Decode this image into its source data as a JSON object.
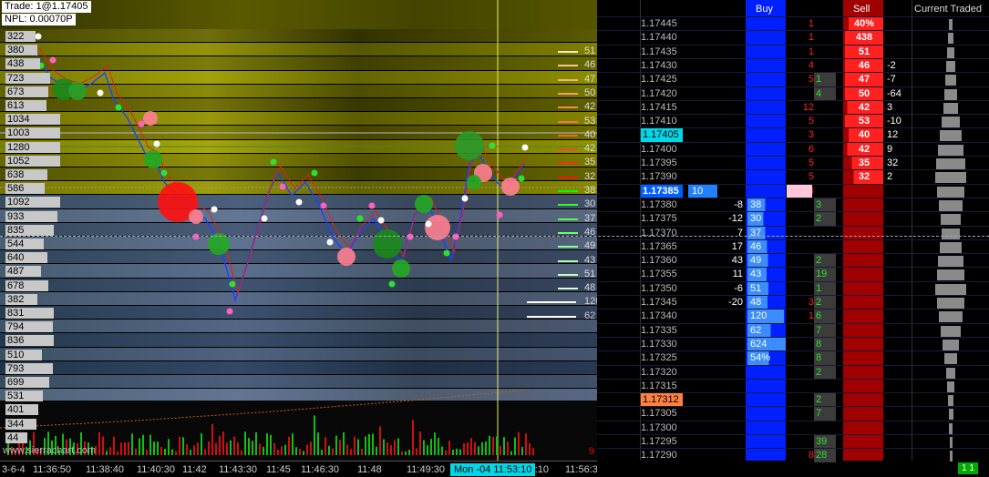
{
  "chart": {
    "trade_label": "Trade: 1@1.17405",
    "npl_label": "NPL: 0.00070P",
    "watermark": "www.sierrachart.com",
    "corner_value": "9",
    "volume_profile": [
      "322",
      "380",
      "438",
      "723",
      "673",
      "613",
      "1034",
      "1003",
      "1280",
      "1052",
      "638",
      "586",
      "1092",
      "933",
      "835",
      "544",
      "640",
      "487",
      "678",
      "382",
      "831",
      "794",
      "836",
      "510",
      "793",
      "699",
      "531",
      "401",
      "344",
      "44"
    ],
    "trades_right": [
      {
        "value": "51",
        "color": "#f4e6c8"
      },
      {
        "value": "46",
        "color": "#f0c88c"
      },
      {
        "value": "47",
        "color": "#f0b478"
      },
      {
        "value": "50",
        "color": "#f0a064"
      },
      {
        "value": "42",
        "color": "#f08c50"
      },
      {
        "value": "53",
        "color": "#f0783c"
      },
      {
        "value": "40",
        "color": "#f06428"
      },
      {
        "value": "42",
        "color": "#f04a1e"
      },
      {
        "value": "35",
        "color": "#f03014"
      },
      {
        "value": "32",
        "color": "#ff1010"
      },
      {
        "value": "38",
        "color": "#00ff00"
      },
      {
        "value": "30",
        "color": "#2cff2c"
      },
      {
        "value": "37",
        "color": "#4cff4c"
      },
      {
        "value": "46",
        "color": "#6cff6c"
      },
      {
        "value": "49",
        "color": "#8cff8c"
      },
      {
        "value": "43",
        "color": "#a8ffa8"
      },
      {
        "value": "51",
        "color": "#c0ffc0"
      },
      {
        "value": "48",
        "color": "#d8ffd8"
      },
      {
        "value": "120",
        "color": "#ffffff"
      },
      {
        "value": "62",
        "color": "#ffffff"
      }
    ],
    "x_ticks": [
      "3-6-4",
      "11:36:50",
      "11:38:40",
      "11:40:30",
      "11:42",
      "11:43:30",
      "11:45",
      "11:46:30",
      "11:48",
      "11:49:30",
      "11:51",
      "11:53:10",
      "11:56:30"
    ],
    "cursor_time": "Mon -04  11:53:10"
  },
  "dom": {
    "header_buy": "Buy",
    "header_sell": "Sell",
    "header_current_traded": "Current Traded",
    "bottom_badge": "1 1",
    "rows": [
      {
        "price": "1.17445",
        "bid": "",
        "ask": "40%",
        "last_buy": "",
        "last_sell": "1",
        "cur": ""
      },
      {
        "price": "1.17440",
        "bid": "",
        "ask": "438",
        "last_buy": "",
        "last_sell": "1",
        "cur": ""
      },
      {
        "price": "1.17435",
        "bid": "",
        "ask": "51",
        "last_buy": "",
        "last_sell": "1",
        "cur": ""
      },
      {
        "price": "1.17430",
        "bid": "",
        "ask": "46",
        "last_buy": "",
        "last_sell": "4",
        "cur": "-2"
      },
      {
        "price": "1.17425",
        "bid": "",
        "ask": "47",
        "last_buy": "1",
        "last_sell": "5",
        "cur": "-7"
      },
      {
        "price": "1.17420",
        "bid": "",
        "ask": "50",
        "last_buy": "4",
        "last_sell": "",
        "cur": "-64"
      },
      {
        "price": "1.17415",
        "bid": "",
        "ask": "42",
        "last_buy": "",
        "last_sell": "12",
        "cur": "3"
      },
      {
        "price": "1.17410",
        "bid": "",
        "ask": "53",
        "last_buy": "",
        "last_sell": "5",
        "cur": "-10"
      },
      {
        "price": "1.17405",
        "bid": "",
        "ask": "40",
        "last_buy": "",
        "last_sell": "3",
        "cur": "12"
      },
      {
        "price": "1.17400",
        "bid": "",
        "ask": "42",
        "last_buy": "",
        "last_sell": "6",
        "cur": "9"
      },
      {
        "price": "1.17395",
        "bid": "",
        "ask": "35",
        "last_buy": "",
        "last_sell": "5",
        "cur": "32"
      },
      {
        "price": "1.17390",
        "bid": "",
        "ask": "32",
        "last_buy": "",
        "last_sell": "5",
        "cur": "2"
      },
      {
        "price": "1.17385",
        "bid": "10",
        "ask": "",
        "last_buy": "",
        "last_sell": "4",
        "cur": ""
      },
      {
        "price": "1.17380",
        "bid": "38",
        "ask": "",
        "last_buy": "3",
        "last_sell": "",
        "cur": "-8"
      },
      {
        "price": "1.17375",
        "bid": "30",
        "ask": "",
        "last_buy": "2",
        "last_sell": "",
        "cur": "-12"
      },
      {
        "price": "1.17370",
        "bid": "37",
        "ask": "",
        "last_buy": "",
        "last_sell": "",
        "cur": "7"
      },
      {
        "price": "1.17365",
        "bid": "46",
        "ask": "",
        "last_buy": "",
        "last_sell": "",
        "cur": "17"
      },
      {
        "price": "1.17360",
        "bid": "49",
        "ask": "",
        "last_buy": "2",
        "last_sell": "",
        "cur": "43"
      },
      {
        "price": "1.17355",
        "bid": "43",
        "ask": "",
        "last_buy": "19",
        "last_sell": "",
        "cur": "11"
      },
      {
        "price": "1.17350",
        "bid": "51",
        "ask": "",
        "last_buy": "1",
        "last_sell": "",
        "cur": "-6"
      },
      {
        "price": "1.17345",
        "bid": "48",
        "ask": "",
        "last_buy": "2",
        "last_sell": "3",
        "cur": "-20"
      },
      {
        "price": "1.17340",
        "bid": "120",
        "ask": "",
        "last_buy": "6",
        "last_sell": "1",
        "cur": ""
      },
      {
        "price": "1.17335",
        "bid": "62",
        "ask": "",
        "last_buy": "7",
        "last_sell": "",
        "cur": ""
      },
      {
        "price": "1.17330",
        "bid": "624",
        "ask": "",
        "last_buy": "8",
        "last_sell": "",
        "cur": ""
      },
      {
        "price": "1.17325",
        "bid": "54%",
        "ask": "",
        "last_buy": "8",
        "last_sell": "",
        "cur": ""
      },
      {
        "price": "1.17320",
        "bid": "",
        "ask": "",
        "last_buy": "2",
        "last_sell": "",
        "cur": ""
      },
      {
        "price": "1.17315",
        "bid": "",
        "ask": "",
        "last_buy": "",
        "last_sell": "",
        "cur": ""
      },
      {
        "price": "1.17312",
        "bid": "",
        "ask": "",
        "last_buy": "2",
        "last_sell": "",
        "cur": ""
      },
      {
        "price": "1.17305",
        "bid": "",
        "ask": "",
        "last_buy": "7",
        "last_sell": "",
        "cur": ""
      },
      {
        "price": "1.17300",
        "bid": "",
        "ask": "",
        "last_buy": "",
        "last_sell": "",
        "cur": ""
      },
      {
        "price": "1.17295",
        "bid": "",
        "ask": "",
        "last_buy": "39",
        "last_sell": "",
        "cur": ""
      },
      {
        "price": "1.17290",
        "bid": "",
        "ask": "",
        "last_buy": "28",
        "last_sell": "8",
        "cur": ""
      }
    ],
    "traded_profile": [
      4,
      6,
      8,
      10,
      12,
      14,
      16,
      20,
      24,
      28,
      32,
      34,
      30,
      26,
      22,
      20,
      24,
      28,
      30,
      34,
      30,
      26,
      22,
      18,
      14,
      10,
      8,
      6,
      5,
      4,
      3,
      3
    ]
  }
}
